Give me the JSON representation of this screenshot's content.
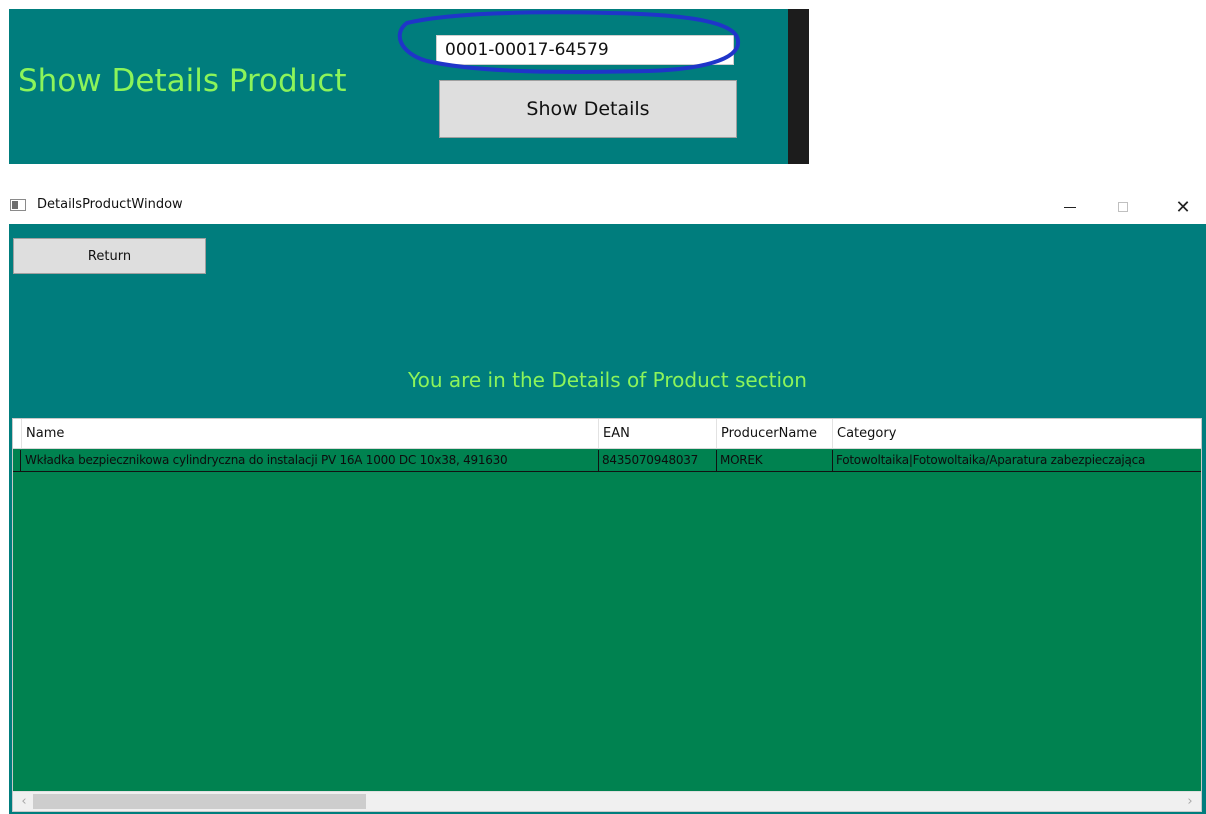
{
  "top_panel": {
    "title": "Show Details Product",
    "product_code_value": "0001-00017-64579",
    "show_details_label": "Show Details"
  },
  "window": {
    "title": "DetailsProductWindow",
    "return_label": "Return",
    "section_heading": "You are in the Details of Product section"
  },
  "grid": {
    "columns": [
      "Name",
      "EAN",
      "ProducerName",
      "Category"
    ],
    "rows": [
      {
        "name": "Wkładka bezpiecznikowa cylindryczna do instalacji PV 16A 1000 DC 10x38, 491630",
        "ean": "8435070948037",
        "producer": "MOREK",
        "category": "Fotowoltaika|Fotowoltaika/Aparatura zabezpieczająca"
      }
    ]
  },
  "colors": {
    "panel_bg": "#007d7d",
    "accent_text": "#8cf45a",
    "grid_bg": "#008250",
    "annotation_ink": "#1f35c9"
  },
  "icons": [
    "app-window-icon",
    "minimize-icon",
    "maximize-icon",
    "close-icon",
    "chevron-left-icon",
    "chevron-right-icon"
  ]
}
